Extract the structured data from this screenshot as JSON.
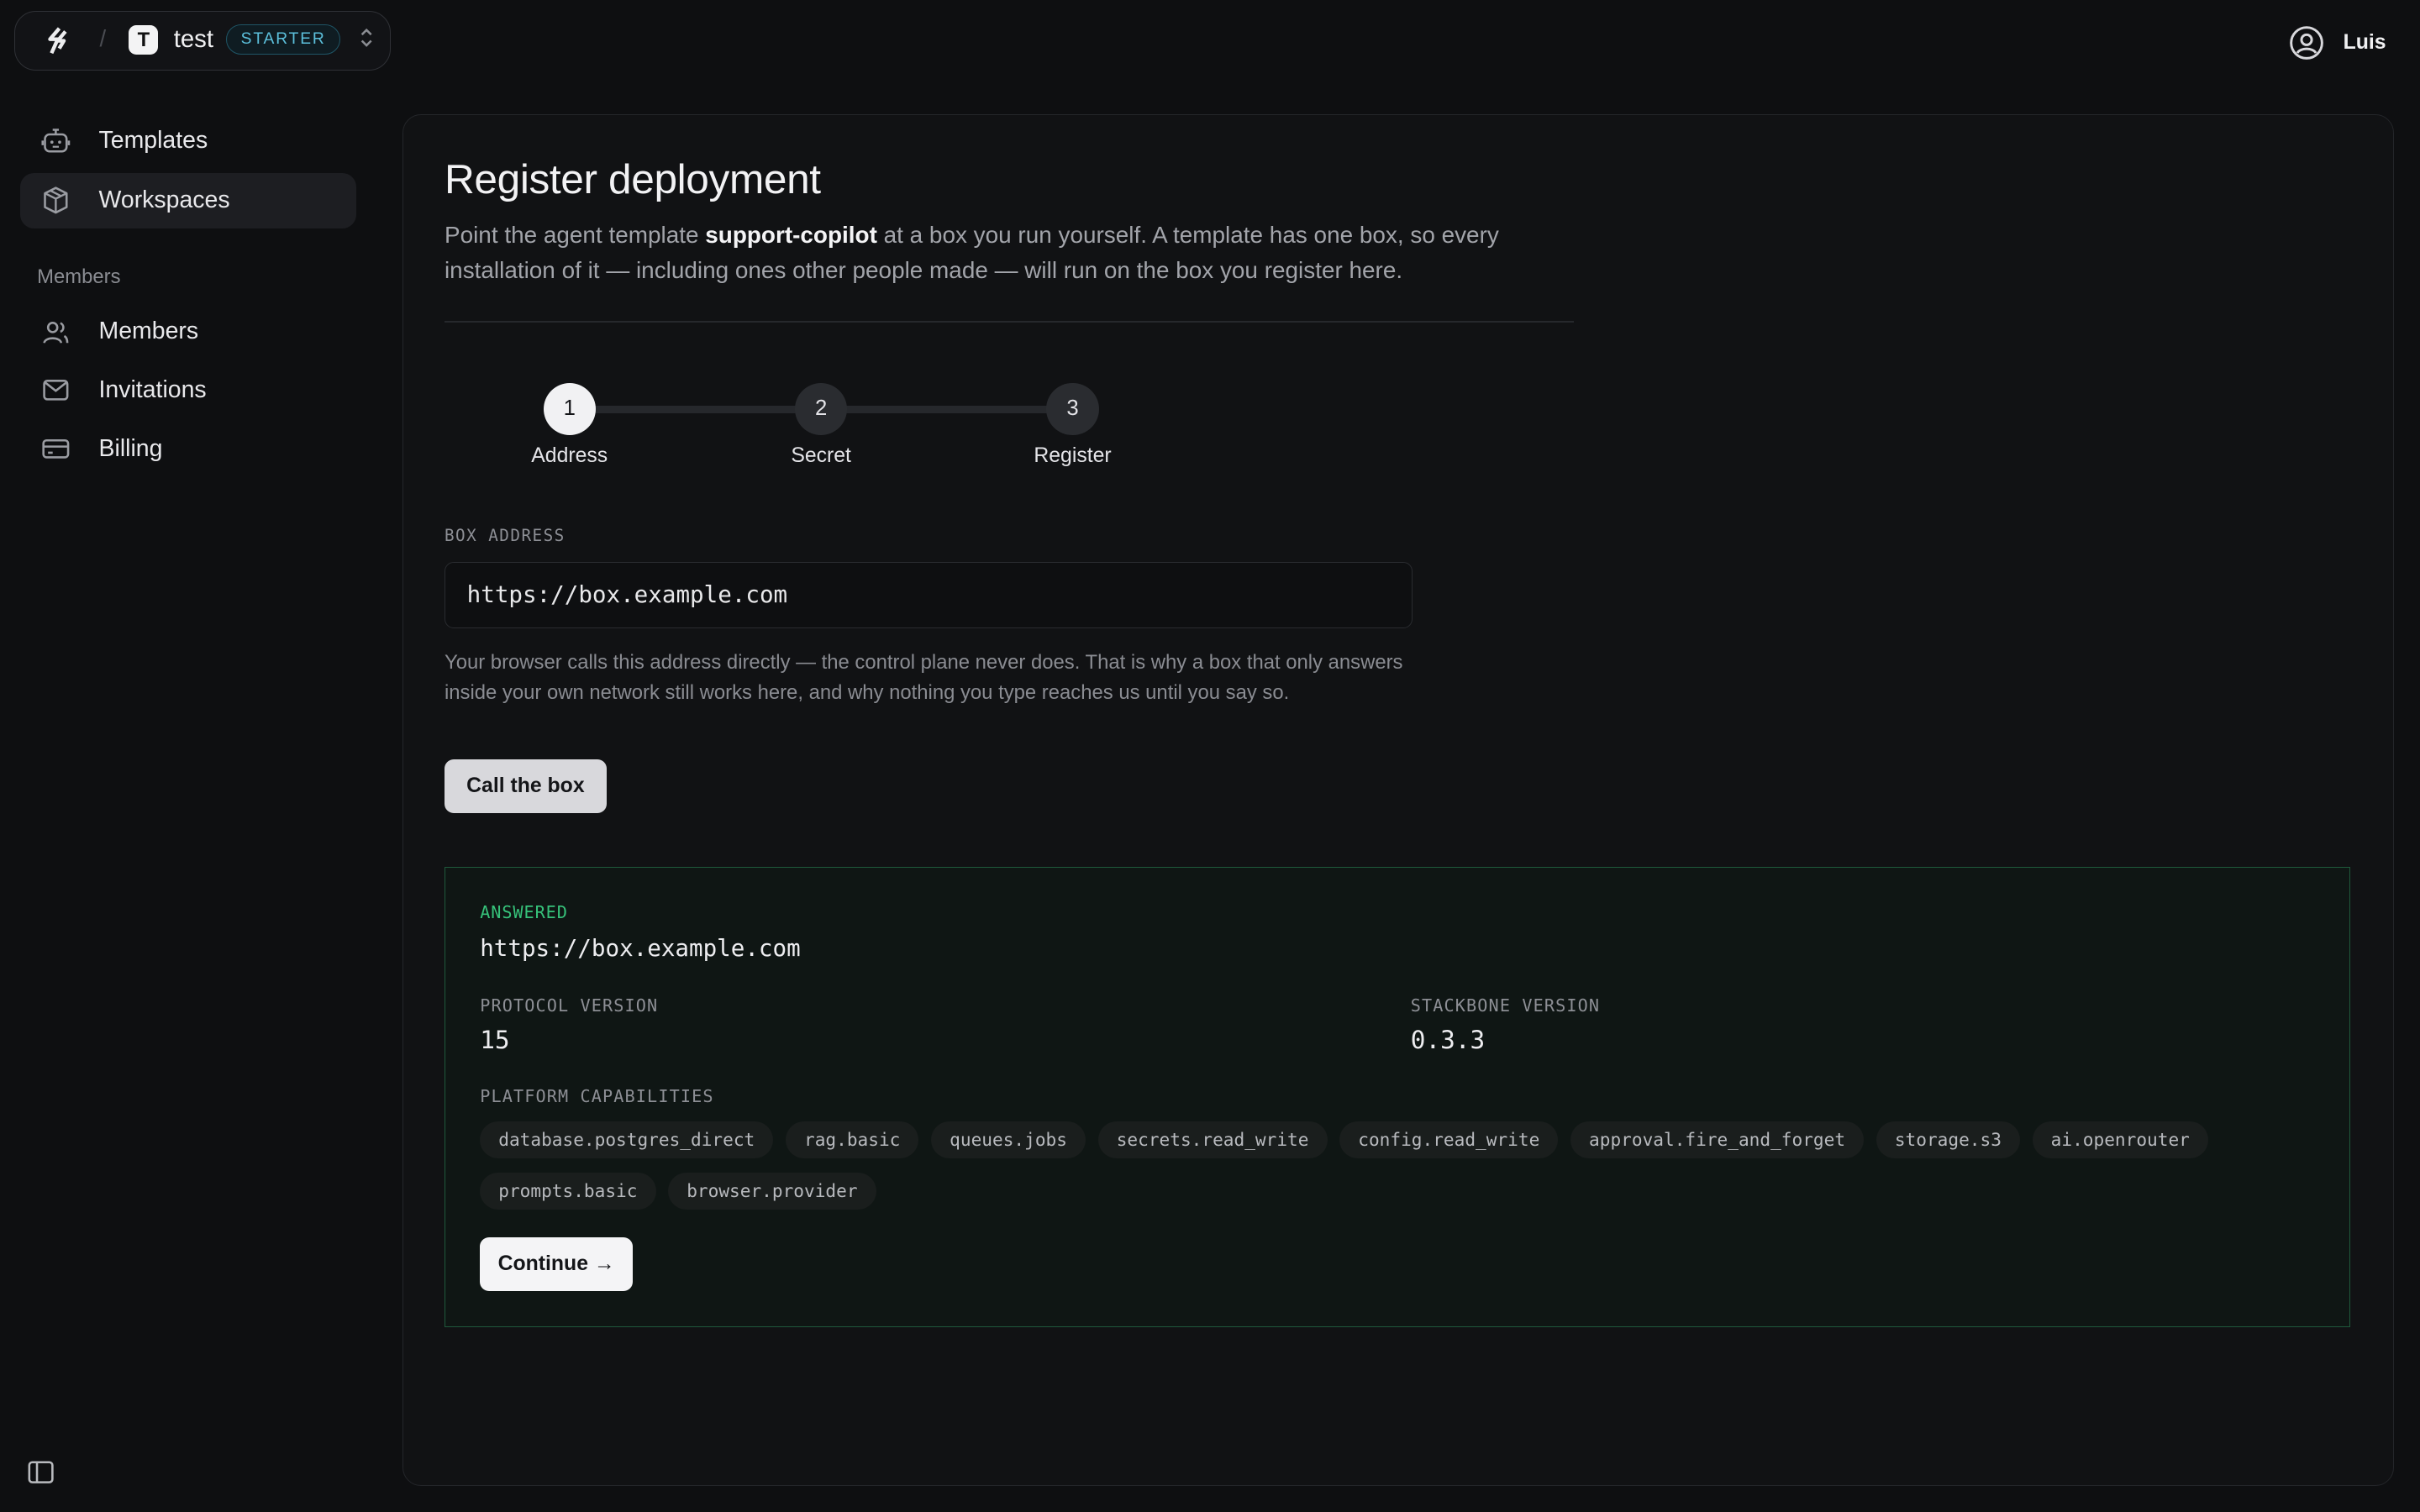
{
  "topbar": {
    "workspace_initial": "T",
    "workspace_name": "test",
    "plan": "STARTER",
    "user_name": "Luis"
  },
  "sidebar": {
    "items": [
      {
        "label": "Templates",
        "icon": "robot-icon"
      },
      {
        "label": "Workspaces",
        "icon": "box-icon",
        "active": true
      }
    ],
    "section_label": "Members",
    "member_items": [
      {
        "label": "Members",
        "icon": "users-icon"
      },
      {
        "label": "Invitations",
        "icon": "mail-icon"
      },
      {
        "label": "Billing",
        "icon": "credit-card-icon"
      }
    ]
  },
  "main": {
    "title": "Register deployment",
    "intro_before": "Point the agent template ",
    "intro_template": "support-copilot",
    "intro_after": " at a box you run yourself. A template has one box, so every installation of it — including ones other people made — will run on the box you register here.",
    "steps": [
      {
        "number": "1",
        "label": "Address",
        "active": true
      },
      {
        "number": "2",
        "label": "Secret",
        "active": false
      },
      {
        "number": "3",
        "label": "Register",
        "active": false
      }
    ],
    "box_address_label": "BOX ADDRESS",
    "box_address_value": "https://box.example.com",
    "help_text": "Your browser calls this address directly — the control plane never does. That is why a box that only answers inside your own network still works here, and why nothing you type reaches us until you say so.",
    "call_button": "Call the box",
    "result": {
      "status": "ANSWERED",
      "url": "https://box.example.com",
      "protocol_label": "PROTOCOL VERSION",
      "protocol_value": "15",
      "stackbone_label": "STACKBONE VERSION",
      "stackbone_value": "0.3.3",
      "capabilities_label": "PLATFORM CAPABILITIES",
      "capabilities": [
        "database.postgres_direct",
        "rag.basic",
        "queues.jobs",
        "secrets.read_write",
        "config.read_write",
        "approval.fire_and_forget",
        "storage.s3",
        "ai.openrouter",
        "prompts.basic",
        "browser.provider"
      ],
      "continue_button": "Continue →"
    }
  },
  "colors": {
    "background": "#0e0f11",
    "panel": "#111214",
    "accent_success": "#36c27a",
    "badge_text": "#5cc0dc"
  }
}
